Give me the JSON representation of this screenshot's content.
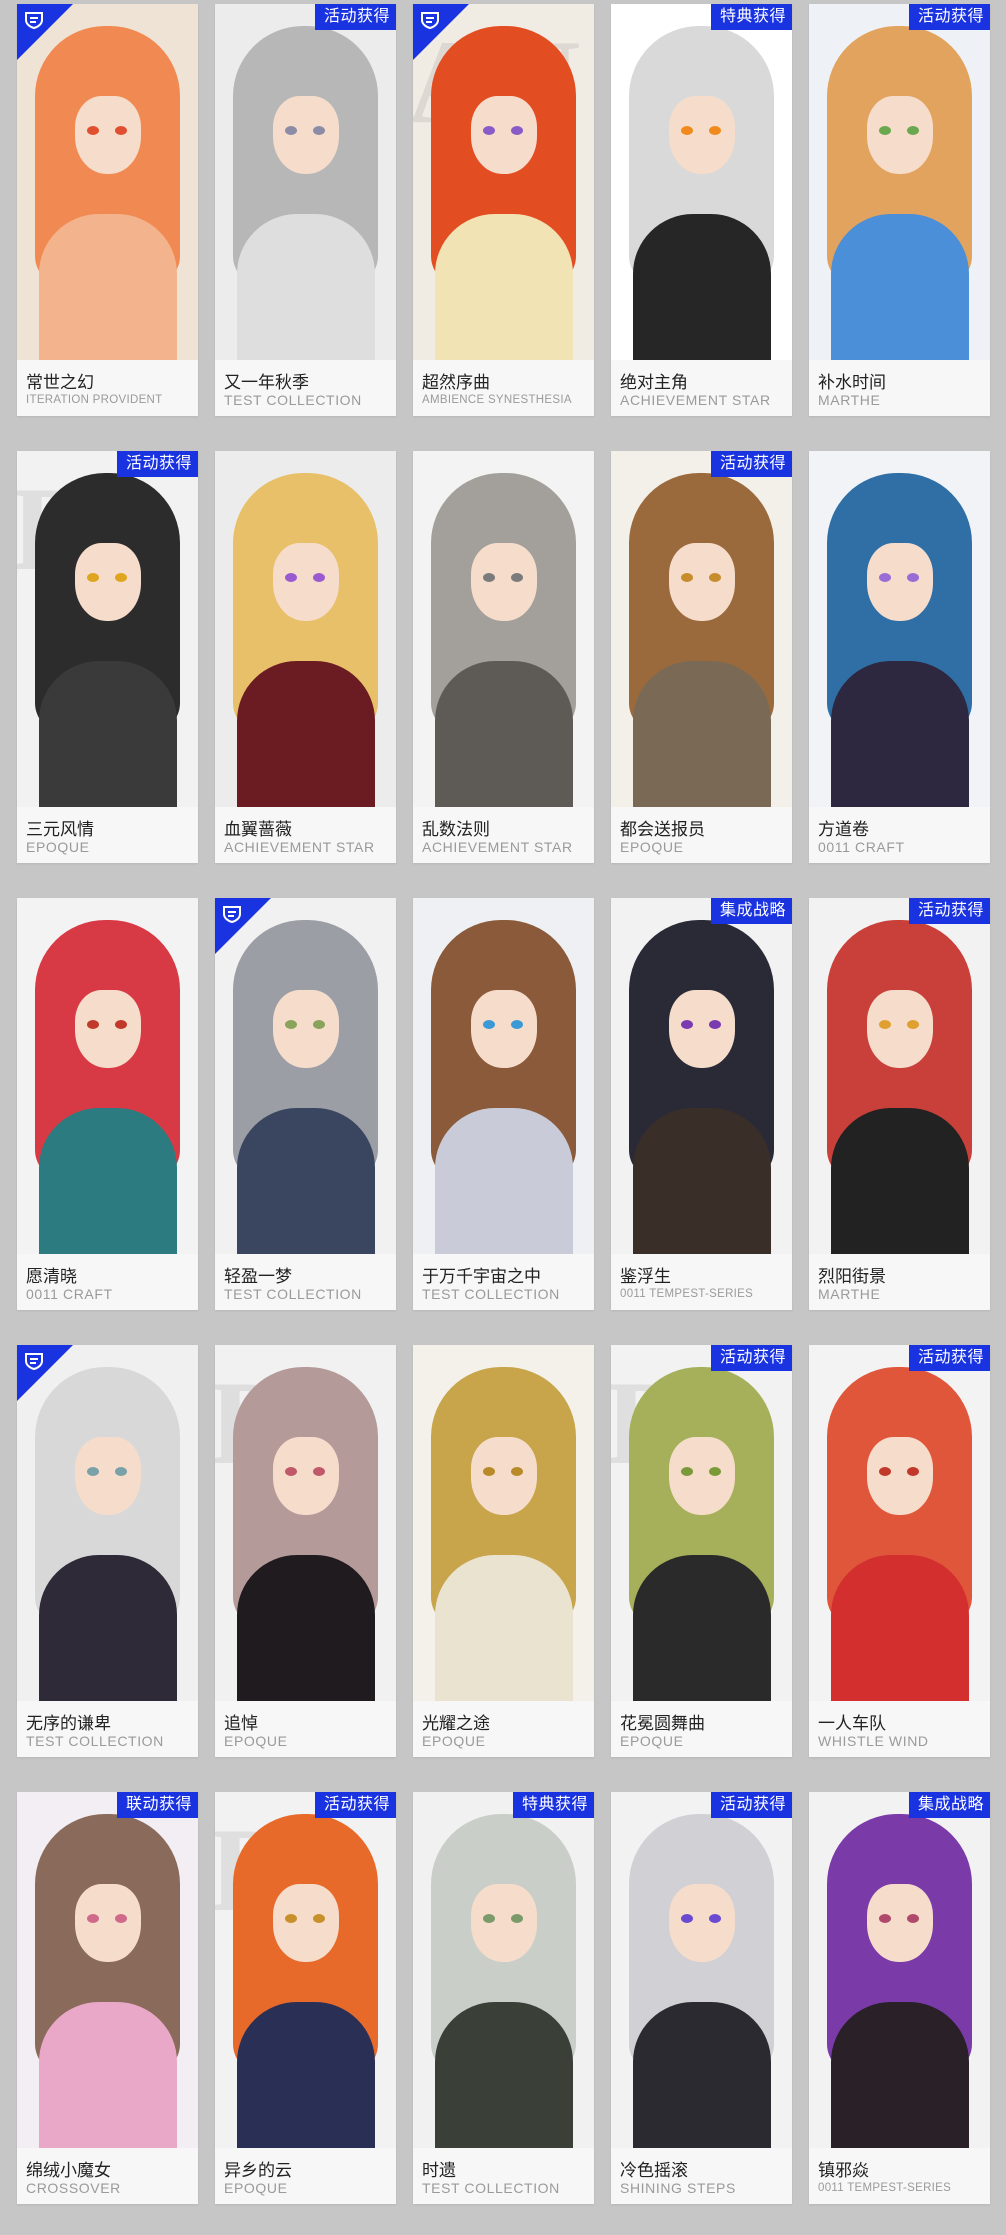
{
  "colors": {
    "badge_bg": "#1a33e0",
    "badge_text": "#ffffff",
    "page_bg": "#c6c6c6",
    "card_bg": "#f6f6f6",
    "name_text": "#222222",
    "series_text": "#9a9a9a"
  },
  "icons": {
    "corner": "pledge-icon"
  },
  "cards": [
    {
      "name": "常世之幻",
      "series": "ITERATION PROVIDENT",
      "badge": "",
      "corner": true,
      "hair": "#f08a52",
      "eye": "#e04f2f",
      "body": "#f3b48d",
      "bg": "#efe3d6",
      "bgtxt": ""
    },
    {
      "name": "又一年秋季",
      "series": "TEST COLLECTION",
      "badge": "活动获得",
      "corner": false,
      "hair": "#b7b7b7",
      "eye": "#8c8ca6",
      "body": "#dedede",
      "bg": "#ececec",
      "bgtxt": ""
    },
    {
      "name": "超然序曲",
      "series": "AMBIENCE SYNESTHESIA",
      "badge": "",
      "corner": true,
      "hair": "#e34d22",
      "eye": "#8a5bc7",
      "body": "#f1e3b4",
      "bg": "#f0ece4",
      "bgtxt": "AN"
    },
    {
      "name": "绝对主角",
      "series": "ACHIEVEMENT STAR",
      "badge": "特典获得",
      "corner": false,
      "hair": "#d9d9d9",
      "eye": "#f08a1c",
      "body": "#262626",
      "bg": "#ffffff",
      "bgtxt": ""
    },
    {
      "name": "补水时间",
      "series": "MARTHE",
      "badge": "活动获得",
      "corner": false,
      "hair": "#e2a35f",
      "eye": "#6aa84f",
      "body": "#4a8fd8",
      "bg": "#eef2f6",
      "bgtxt": ""
    },
    {
      "name": "三元风情",
      "series": "EPOQUE",
      "badge": "活动获得",
      "corner": false,
      "hair": "#2c2c2c",
      "eye": "#e0a51e",
      "body": "#3a3a3a",
      "bg": "#f2f2f2",
      "bgtxt": "D"
    },
    {
      "name": "血翼蔷薇",
      "series": "ACHIEVEMENT STAR",
      "badge": "",
      "corner": false,
      "hair": "#e8c06a",
      "eye": "#9b5bd0",
      "body": "#6b1b22",
      "bg": "#ececec",
      "bgtxt": ""
    },
    {
      "name": "乱数法则",
      "series": "ACHIEVEMENT STAR",
      "badge": "",
      "corner": false,
      "hair": "#a3a09b",
      "eye": "#7b7b7b",
      "body": "#5e5a55",
      "bg": "#f3f3f3",
      "bgtxt": ""
    },
    {
      "name": "都会送报员",
      "series": "EPOQUE",
      "badge": "活动获得",
      "corner": false,
      "hair": "#9a6a3d",
      "eye": "#c78d2c",
      "body": "#7a6a55",
      "bg": "#f3efe9",
      "bgtxt": ""
    },
    {
      "name": "方道卷",
      "series": "0011 CRAFT",
      "badge": "",
      "corner": false,
      "hair": "#2f6fa5",
      "eye": "#9b6bd6",
      "body": "#2d2840",
      "bg": "#f1f3f6",
      "bgtxt": ""
    },
    {
      "name": "愿清晓",
      "series": "0011 CRAFT",
      "badge": "",
      "corner": false,
      "hair": "#d73a44",
      "eye": "#c0392b",
      "body": "#2b7b80",
      "bg": "#f3f3f3",
      "bgtxt": ""
    },
    {
      "name": "轻盈一梦",
      "series": "TEST COLLECTION",
      "badge": "",
      "corner": true,
      "hair": "#9c9ea5",
      "eye": "#8aa35a",
      "body": "#3a4560",
      "bg": "#f1f1f1",
      "bgtxt": ""
    },
    {
      "name": "于万千宇宙之中",
      "series": "TEST COLLECTION",
      "badge": "",
      "corner": false,
      "hair": "#8a5a3a",
      "eye": "#3b9ad6",
      "body": "#c9ccd8",
      "bg": "#eef0f3",
      "bgtxt": ""
    },
    {
      "name": "鉴浮生",
      "series": "0011 TEMPEST-SERIES",
      "badge": "集成战略",
      "corner": false,
      "hair": "#2a2a36",
      "eye": "#7a3ab0",
      "body": "#3a2e28",
      "bg": "#f2f2f2",
      "bgtxt": ""
    },
    {
      "name": "烈阳街景",
      "series": "MARTHE",
      "badge": "活动获得",
      "corner": false,
      "hair": "#c9403a",
      "eye": "#e0a030",
      "body": "#222222",
      "bg": "#f2f2f2",
      "bgtxt": ""
    },
    {
      "name": "无序的谦卑",
      "series": "TEST COLLECTION",
      "badge": "",
      "corner": true,
      "hair": "#d8d8d8",
      "eye": "#7aa0a8",
      "body": "#2e2a38",
      "bg": "#f0f0f0",
      "bgtxt": ""
    },
    {
      "name": "追悼",
      "series": "EPOQUE",
      "badge": "",
      "corner": false,
      "hair": "#b59a9a",
      "eye": "#c05a6a",
      "body": "#1f1b1f",
      "bg": "#f1f1f1",
      "bgtxt": "D"
    },
    {
      "name": "光耀之途",
      "series": "EPOQUE",
      "badge": "",
      "corner": false,
      "hair": "#c8a44a",
      "eye": "#b88a2a",
      "body": "#e9e3d0",
      "bg": "#f3f1ea",
      "bgtxt": ""
    },
    {
      "name": "花冕圆舞曲",
      "series": "EPOQUE",
      "badge": "活动获得",
      "corner": false,
      "hair": "#a6b05a",
      "eye": "#7a9a3a",
      "body": "#2a2a2a",
      "bg": "#f2f2f2",
      "bgtxt": "D"
    },
    {
      "name": "一人车队",
      "series": "WHISTLE WIND",
      "badge": "活动获得",
      "corner": false,
      "hair": "#e0563a",
      "eye": "#c0392b",
      "body": "#d32f2f",
      "bg": "#f3f3f3",
      "bgtxt": ""
    },
    {
      "name": "绵绒小魔女",
      "series": "CROSSOVER",
      "badge": "联动获得",
      "corner": false,
      "hair": "#8a6a5a",
      "eye": "#d06a8a",
      "body": "#e9a8c8",
      "bg": "#f3eef3",
      "bgtxt": ""
    },
    {
      "name": "异乡的云",
      "series": "EPOQUE",
      "badge": "活动获得",
      "corner": false,
      "hair": "#e86a2a",
      "eye": "#c8902a",
      "body": "#2a2f55",
      "bg": "#f2f2f2",
      "bgtxt": "D"
    },
    {
      "name": "时遗",
      "series": "TEST COLLECTION",
      "badge": "特典获得",
      "corner": false,
      "hair": "#c9cfc8",
      "eye": "#7a9a6a",
      "body": "#3a4038",
      "bg": "#f1f1f1",
      "bgtxt": ""
    },
    {
      "name": "冷色摇滚",
      "series": "SHINING STEPS",
      "badge": "活动获得",
      "corner": false,
      "hair": "#d0d0d5",
      "eye": "#6a4ad0",
      "body": "#2a2a30",
      "bg": "#f2f2f2",
      "bgtxt": ""
    },
    {
      "name": "镇邪焱",
      "series": "0011 TEMPEST-SERIES",
      "badge": "集成战略",
      "corner": false,
      "hair": "#7a3aa8",
      "eye": "#b04a6a",
      "body": "#2a2028",
      "bg": "#f2f2f2",
      "bgtxt": ""
    }
  ]
}
